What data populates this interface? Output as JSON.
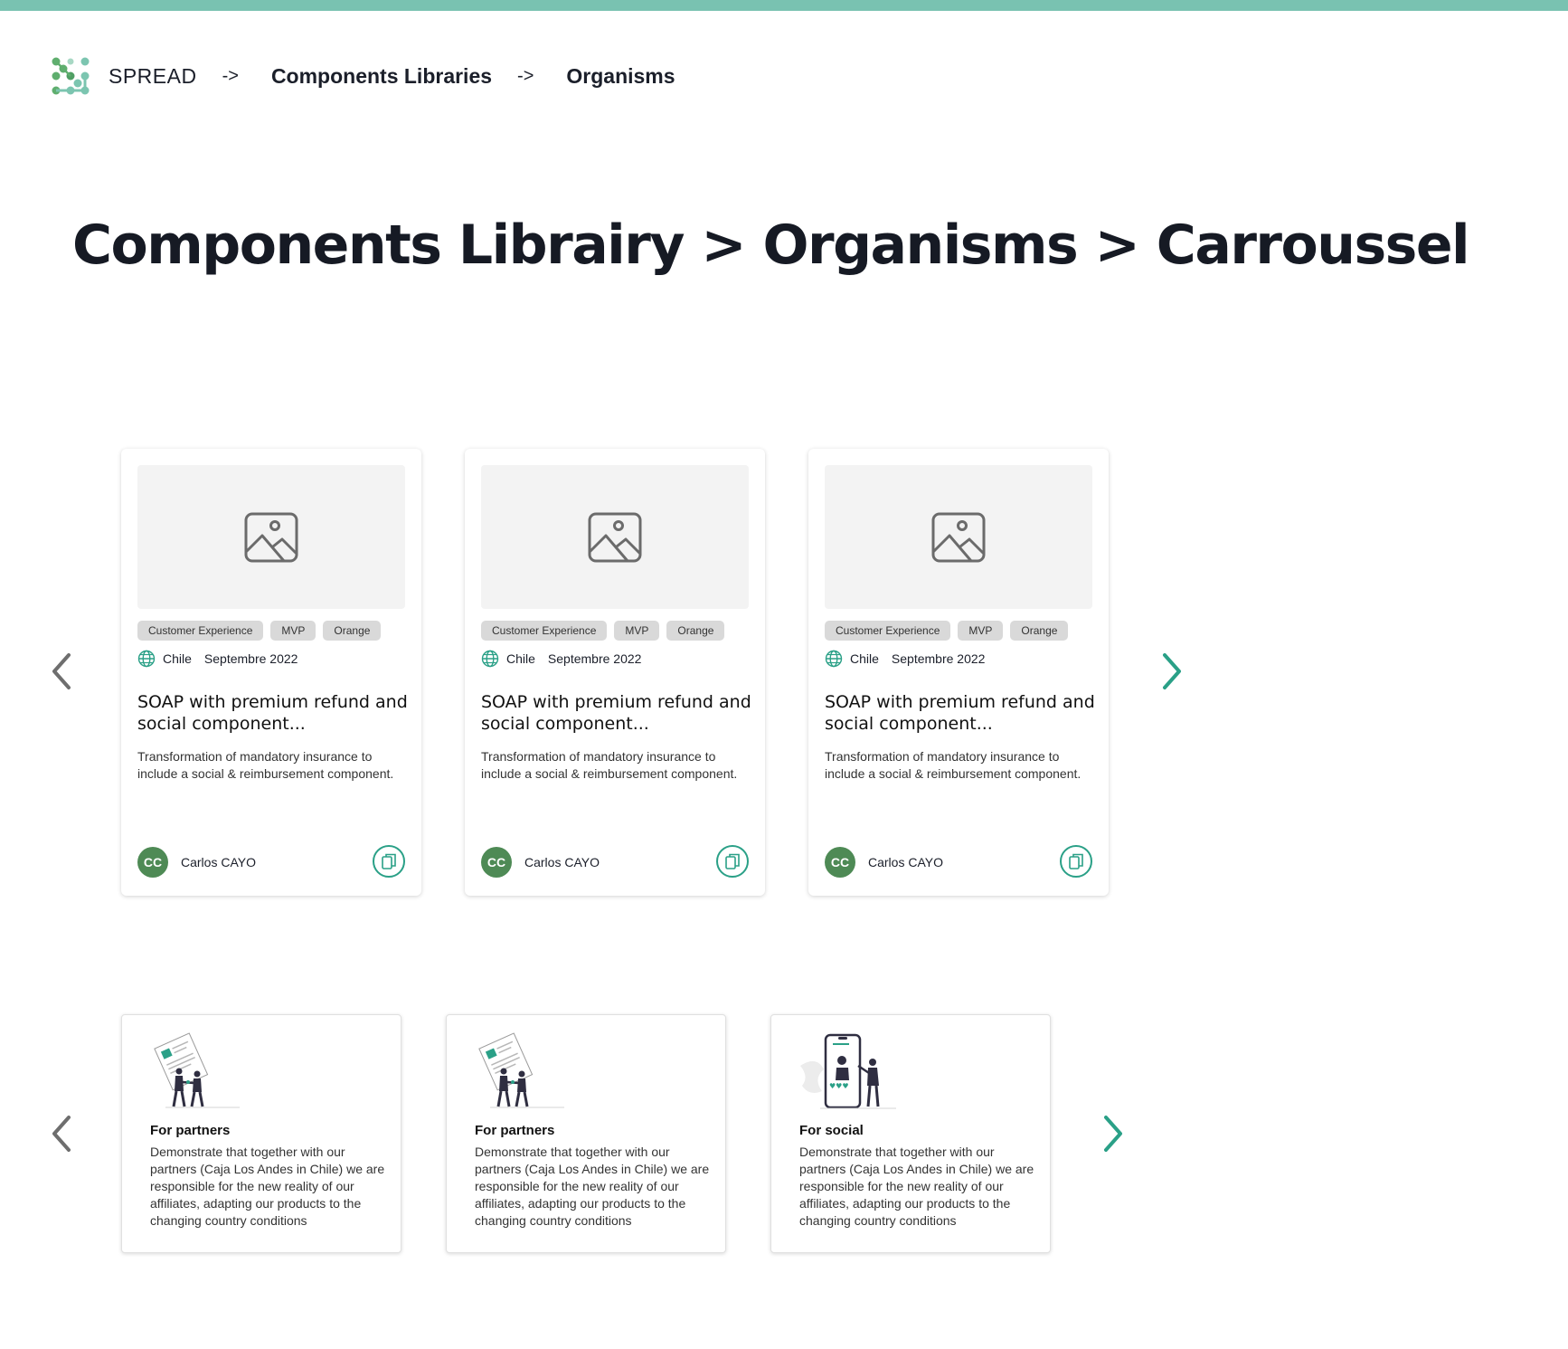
{
  "header": {
    "brand": "SPREAD",
    "separator": "->",
    "crumbs": [
      "Components Libraries",
      "Organisms"
    ]
  },
  "page_title": "Components Librairy  > Organisms > Carroussel",
  "colors": {
    "accent": "#79c2b1",
    "teal": "#2aa087",
    "avatar": "#4e8a55",
    "tag_bg": "#d9d9d9"
  },
  "carousel_1": {
    "prev_icon": "chevron-left-icon",
    "next_icon": "chevron-right-icon",
    "cards": [
      {
        "image_icon": "image-placeholder-icon",
        "tags": [
          "Customer Experience",
          "MVP",
          "Orange"
        ],
        "country": "Chile",
        "date": "Septembre 2022",
        "title": "SOAP with premium refund and social component...",
        "description": "Transformation of mandatory insurance to include a social & reimbursement component.",
        "author_initials": "CC",
        "author_name": "Carlos CAYO",
        "action_icon": "copy-icon"
      },
      {
        "image_icon": "image-placeholder-icon",
        "tags": [
          "Customer Experience",
          "MVP",
          "Orange"
        ],
        "country": "Chile",
        "date": "Septembre 2022",
        "title": "SOAP with premium refund and social component...",
        "description": "Transformation of mandatory insurance to include a social & reimbursement component.",
        "author_initials": "CC",
        "author_name": "Carlos CAYO",
        "action_icon": "copy-icon"
      },
      {
        "image_icon": "image-placeholder-icon",
        "tags": [
          "Customer Experience",
          "MVP",
          "Orange"
        ],
        "country": "Chile",
        "date": "Septembre 2022",
        "title": "SOAP with premium refund and social component...",
        "description": "Transformation of mandatory insurance to include a social & reimbursement component.",
        "author_initials": "CC",
        "author_name": "Carlos CAYO",
        "action_icon": "copy-icon"
      }
    ]
  },
  "carousel_2": {
    "prev_icon": "chevron-left-icon",
    "next_icon": "chevron-right-icon",
    "cards": [
      {
        "illustration": "partners-handshake-illustration",
        "title": "For partners",
        "text": "Demonstrate that together with our partners (Caja Los Andes in Chile) we are responsible for the new reality of our affiliates, adapting our products to the changing country conditions"
      },
      {
        "illustration": "partners-handshake-illustration",
        "title": "For partners",
        "text": "Demonstrate that together with our partners (Caja Los Andes in Chile) we are responsible for the new reality of our affiliates, adapting our products to the changing country conditions"
      },
      {
        "illustration": "social-phone-illustration",
        "title": "For social",
        "text": "Demonstrate that together with our partners (Caja Los Andes in Chile) we are responsible for the new reality of our affiliates, adapting our products to the changing country conditions"
      }
    ]
  }
}
